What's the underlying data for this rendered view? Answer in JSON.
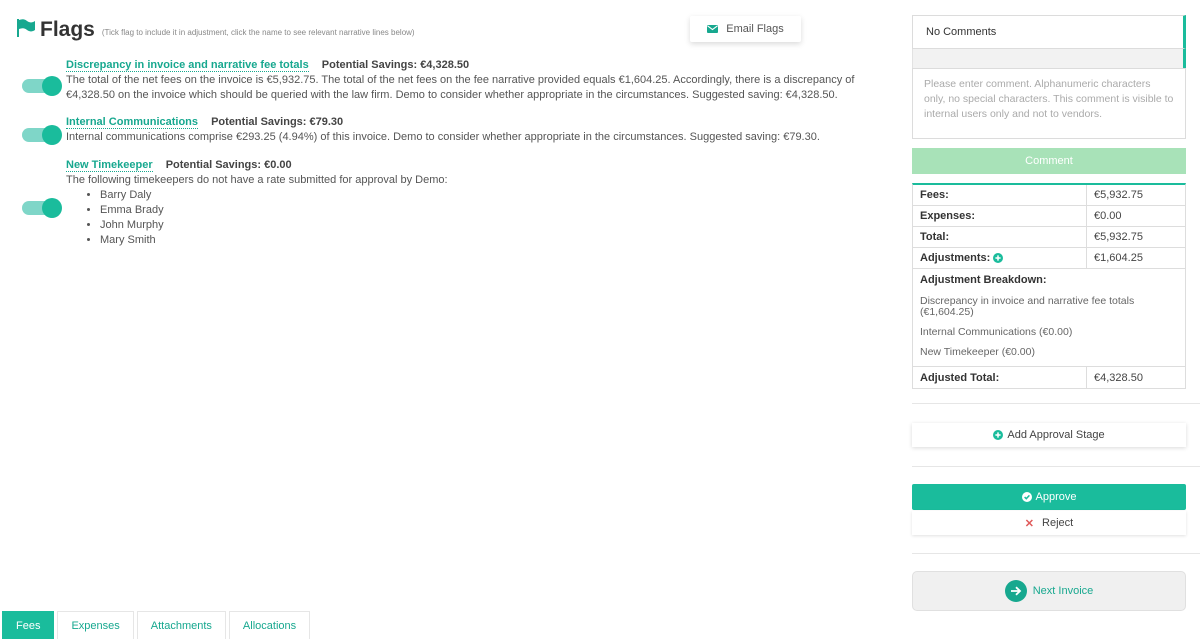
{
  "header": {
    "title": "Flags",
    "hint": "(Tick flag to include it in adjustment, click the name to see relevant narrative lines below)",
    "email_button": "Email Flags"
  },
  "flags": [
    {
      "name": "Discrepancy in invoice and narrative fee totals",
      "savings": "Potential Savings: €4,328.50",
      "text": "The total of the net fees on the invoice is €5,932.75. The total of the net fees on the fee narrative provided equals €1,604.25. Accordingly, there is a discrepancy of €4,328.50 on the invoice which should be queried with the law firm. Demo to consider whether appropriate in the circumstances. Suggested saving: €4,328.50.",
      "enabled": true
    },
    {
      "name": "Internal Communications",
      "savings": "Potential Savings: €79.30",
      "text": "Internal communications comprise €293.25 (4.94%) of this invoice. Demo to consider whether appropriate in the circumstances. Suggested saving: €79.30.",
      "enabled": true
    },
    {
      "name": "New Timekeeper",
      "savings": "Potential Savings: €0.00",
      "text": "The following timekeepers do not have a rate submitted for approval by Demo:",
      "timekeepers": [
        "Barry Daly",
        "Emma Brady",
        "John Murphy",
        "Mary Smith"
      ],
      "enabled": true
    }
  ],
  "tabs": [
    {
      "label": "Fees",
      "active": true
    },
    {
      "label": "Expenses",
      "active": false
    },
    {
      "label": "Attachments",
      "active": false
    },
    {
      "label": "Allocations",
      "active": false
    }
  ],
  "comments": {
    "select_value": "No Comments",
    "placeholder": "Please enter comment. Alphanumeric characters only, no special characters. This comment is visible to internal users only and not to vendors.",
    "button": "Comment"
  },
  "summary": {
    "fees_label": "Fees:",
    "fees_value": "€5,932.75",
    "expenses_label": "Expenses:",
    "expenses_value": "€0.00",
    "total_label": "Total:",
    "total_value": "€5,932.75",
    "adjustments_label": "Adjustments:",
    "adjustments_value": "€1,604.25",
    "breakdown_title": "Adjustment Breakdown:",
    "breakdown_items": [
      "Discrepancy in invoice and narrative fee totals (€1,604.25)",
      "Internal Communications (€0.00)",
      "New Timekeeper (€0.00)"
    ],
    "adjusted_label": "Adjusted Total:",
    "adjusted_value": "€4,328.50"
  },
  "actions": {
    "add_approval_stage": "Add Approval Stage",
    "approve": "Approve",
    "reject": "Reject",
    "next_invoice": "Next Invoice"
  },
  "colors": {
    "accent": "#1abc9c",
    "link": "#17a88f",
    "comment_button": "#a8e2b8",
    "reject": "#e05a5a"
  }
}
